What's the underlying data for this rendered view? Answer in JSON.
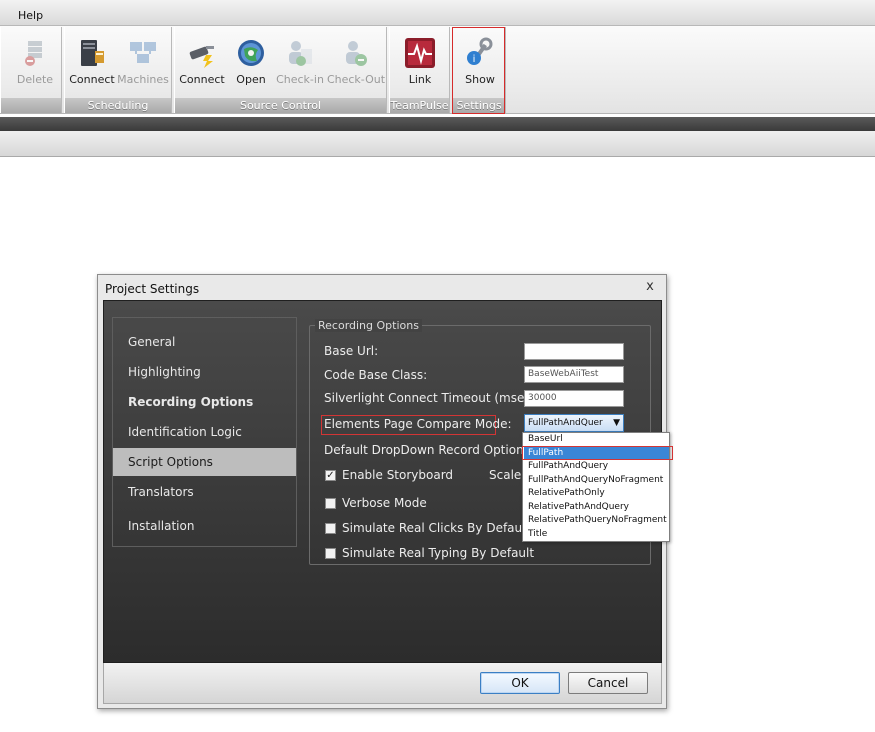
{
  "menu": {
    "help_label": "Help"
  },
  "ribbon": {
    "groups": [
      {
        "label": "",
        "buttons": [
          {
            "label": "Delete",
            "icon": "delete-icon",
            "enabled": false
          }
        ]
      },
      {
        "label": "Scheduling",
        "buttons": [
          {
            "label": "Connect",
            "icon": "server-connect-icon",
            "enabled": true
          },
          {
            "label": "Machines",
            "icon": "machines-icon",
            "enabled": false
          }
        ]
      },
      {
        "label": "Source Control",
        "buttons": [
          {
            "label": "Connect",
            "icon": "plug-connect-icon",
            "enabled": true
          },
          {
            "label": "Open",
            "icon": "globe-open-icon",
            "enabled": true
          },
          {
            "label": "Check-in",
            "icon": "check-in-icon",
            "enabled": false
          },
          {
            "label": "Check-Out",
            "icon": "check-out-icon",
            "enabled": false
          }
        ]
      },
      {
        "label": "TeamPulse",
        "buttons": [
          {
            "label": "Link",
            "icon": "pulse-link-icon",
            "enabled": true
          }
        ]
      },
      {
        "label": "Settings",
        "buttons": [
          {
            "label": "Show",
            "icon": "settings-wrench-icon",
            "enabled": true
          }
        ]
      }
    ]
  },
  "dialog": {
    "title": "Project Settings",
    "close_glyph": "x",
    "nav": [
      {
        "label": "General",
        "selected": false,
        "bold": false
      },
      {
        "label": "Highlighting",
        "selected": false,
        "bold": false
      },
      {
        "label": "Recording Options",
        "selected": false,
        "bold": true
      },
      {
        "label": "Identification Logic",
        "selected": false,
        "bold": false
      },
      {
        "label": "Script Options",
        "selected": true,
        "bold": false
      },
      {
        "label": "Translators",
        "selected": false,
        "bold": false
      },
      {
        "label": "Installation",
        "selected": false,
        "bold": false
      }
    ],
    "group_title": "Recording Options",
    "fields": {
      "base_url_label": "Base Url:",
      "base_url_value": "",
      "code_base_class_label": "Code Base Class:",
      "code_base_class_value": "BaseWebAiiTest",
      "silverlight_timeout_label": "Silverlight Connect Timeout (msec):",
      "silverlight_timeout_value": "30000",
      "compare_mode_label": "Elements Page Compare Mode:",
      "compare_mode_value": "FullPathAndQuer",
      "dropdown_record_label": "Default DropDown Record Option:",
      "scale_label": "Scale:"
    },
    "checkboxes": [
      {
        "label": "Enable Storyboard",
        "checked": true
      },
      {
        "label": "Verbose Mode",
        "checked": false
      },
      {
        "label": "Simulate Real Clicks By Default",
        "checked": false
      },
      {
        "label": "Simulate Real Typing By Default",
        "checked": false
      }
    ],
    "compare_mode_options": [
      "BaseUrl",
      "FullPath",
      "FullPathAndQuery",
      "FullPathAndQueryNoFragment",
      "RelativePathOnly",
      "RelativePathAndQuery",
      "RelativePathQueryNoFragment",
      "Title"
    ],
    "highlighted_option": "FullPath",
    "ok_label": "OK",
    "cancel_label": "Cancel"
  },
  "colors": {
    "selection_blue": "#3a86d6",
    "annotation_red": "#d33535",
    "dialog_dark": "#2c2c2c"
  }
}
